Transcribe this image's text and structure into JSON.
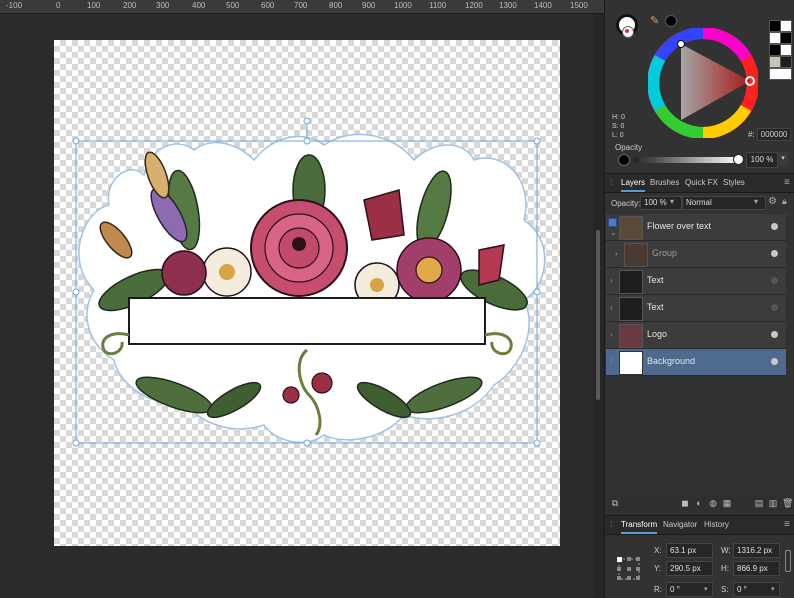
{
  "ruler": {
    "labels": [
      "-100",
      "0",
      "100",
      "200",
      "300",
      "400",
      "500",
      "600",
      "700",
      "800",
      "900",
      "1000",
      "1100",
      "1200",
      "1300",
      "1400",
      "1500"
    ]
  },
  "color_panel": {
    "h_label": "H: 0",
    "s_label": "S: 0",
    "l_label": "L: 0",
    "hex_prefix": "#:",
    "hex_value": "000000",
    "opacity_label": "Opacity",
    "opacity_value": "100 %",
    "primary_color": "#000000",
    "accent": "#e53030",
    "swatches": [
      "#000000",
      "#ffffff",
      "#ffffff",
      "#000000",
      "#000000",
      "#ffffff",
      "#c9c2b8",
      "#1e1e1e"
    ]
  },
  "layers_panel": {
    "tabs": [
      "Layers",
      "Brushes",
      "Quick FX",
      "Styles"
    ],
    "opacity_label": "Opacity:",
    "opacity_value": "100 %",
    "blend_mode": "Normal",
    "layers": [
      {
        "name": "Flower over text",
        "visible": true,
        "expanded": true
      },
      {
        "name": "Group",
        "visible": true,
        "dimmed": true
      },
      {
        "name": "Text",
        "visible": false
      },
      {
        "name": "Text",
        "visible": false
      },
      {
        "name": "Logo",
        "visible": true
      },
      {
        "name": "Background",
        "visible": true,
        "selected": true
      }
    ]
  },
  "transform_panel": {
    "tabs": [
      "Transform",
      "Navigator",
      "History"
    ],
    "x_label": "X:",
    "x_value": "63.1 px",
    "y_label": "Y:",
    "y_value": "290.5 px",
    "w_label": "W:",
    "w_value": "1316.2 px",
    "h_label": "H:",
    "h_value": "866.9 px",
    "r_label": "R:",
    "r_value": "0 °",
    "s_label": "S:",
    "s_value": "0 °"
  }
}
